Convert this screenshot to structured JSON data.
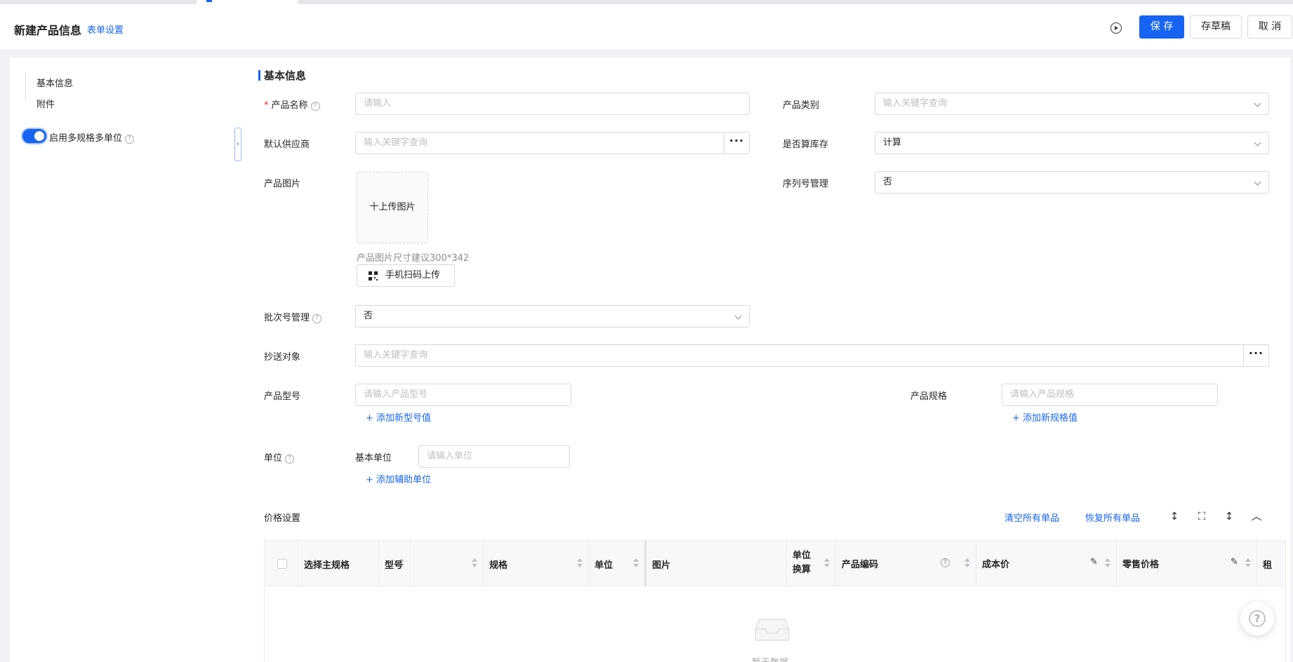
{
  "header": {
    "title": "新建产品信息",
    "form_settings": "表单设置",
    "save_label": "保 存",
    "draft_label": "存草稿",
    "cancel_label": "取 消",
    "accent_color": "#1764f2"
  },
  "sidebar": {
    "items": [
      {
        "label": "基本信息"
      },
      {
        "label": "附件"
      }
    ],
    "toggle_label": "启用多规格多单位",
    "toggle_on": true
  },
  "form": {
    "section_title": "基本信息",
    "product_name": {
      "label": "产品名称",
      "placeholder": "请输入"
    },
    "product_category": {
      "label": "产品类别",
      "placeholder": "输入关键字查询"
    },
    "default_supplier": {
      "label": "默认供应商",
      "placeholder": "输入关键字查询"
    },
    "count_inventory": {
      "label": "是否算库存",
      "value": "计算"
    },
    "product_image": {
      "label": "产品图片",
      "upload_label": "十上传图片",
      "hint": "产品图片尺寸建议300*342",
      "scan_label": "手机扫码上传"
    },
    "serial_management": {
      "label": "序列号管理",
      "value": "否"
    },
    "batch_management": {
      "label": "批次号管理",
      "value": "否"
    },
    "cc_target": {
      "label": "抄送对象",
      "placeholder": "输入关键字查询"
    },
    "product_model": {
      "label": "产品型号",
      "placeholder": "请输入产品型号",
      "add_label": "+ 添加新型号值"
    },
    "product_spec": {
      "label": "产品规格",
      "placeholder": "请输入产品规格",
      "add_label": "+ 添加新规格值"
    },
    "unit": {
      "label": "单位",
      "base_label": "基本单位",
      "placeholder": "请输入单位",
      "add_label": "+ 添加辅助单位"
    }
  },
  "price": {
    "title": "价格设置",
    "clear_all": "清空所有单品",
    "restore_all": "恢复所有单品",
    "columns": [
      "选择主规格",
      "型号",
      "规格",
      "单位",
      "图片",
      "单位换算",
      "产品编码",
      "成本价",
      "零售价格",
      "租"
    ],
    "unit_conv_line1": "单位",
    "unit_conv_line2": "换算",
    "empty_text": "暂无数据"
  }
}
